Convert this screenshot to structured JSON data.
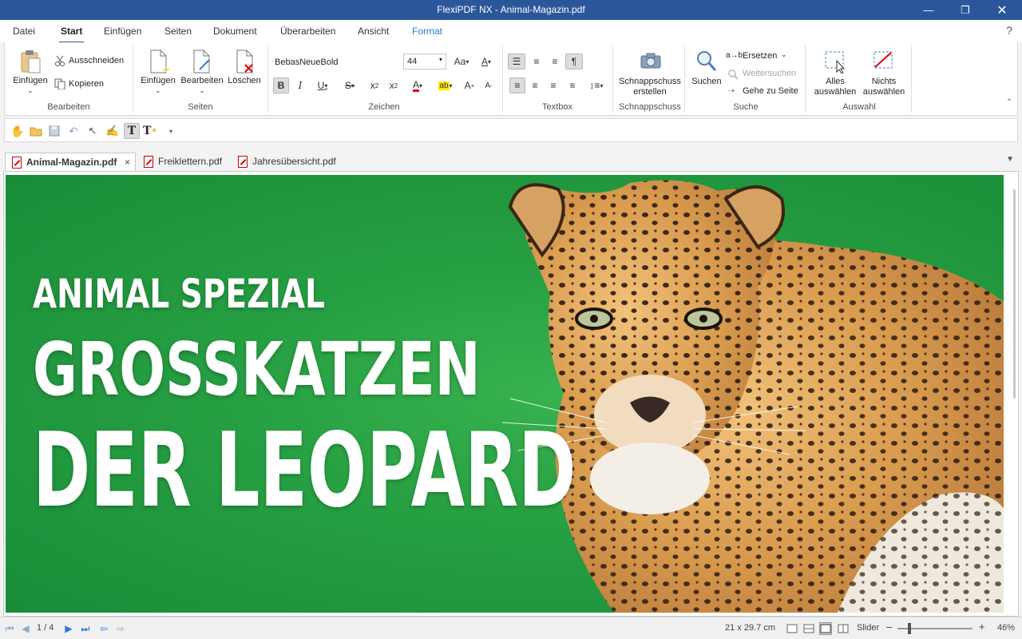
{
  "window": {
    "title": "FlexiPDF NX - Animal-Magazin.pdf"
  },
  "menu": {
    "tabs": [
      "Datei",
      "Start",
      "Einfügen",
      "Seiten",
      "Dokument",
      "Überarbeiten",
      "Ansicht",
      "Format"
    ],
    "active": "Start",
    "help": "?"
  },
  "ribbon": {
    "bearbeiten": {
      "label": "Bearbeiten",
      "paste": "Einfügen",
      "cut": "Ausschneiden",
      "copy": "Kopieren"
    },
    "seiten": {
      "label": "Seiten",
      "insert": "Einfügen",
      "edit": "Bearbeiten",
      "delete": "Löschen"
    },
    "zeichen": {
      "label": "Zeichen",
      "font": "BebasNeueBold",
      "size": "44"
    },
    "textbox": {
      "label": "Textbox"
    },
    "schnappschuss": {
      "label": "Schnappschuss",
      "button_line1": "Schnappschuss",
      "button_line2": "erstellen"
    },
    "suche": {
      "label": "Suche",
      "search": "Suchen",
      "replace": "Ersetzen",
      "find_next": "Weitersuchen",
      "goto_page": "Gehe zu Seite"
    },
    "auswahl": {
      "label": "Auswahl",
      "select_all_1": "Alles",
      "select_all_2": "auswählen",
      "select_none_1": "Nichts",
      "select_none_2": "auswählen"
    }
  },
  "doc_tabs": [
    {
      "label": "Animal-Magazin.pdf",
      "active": true
    },
    {
      "label": "Freiklettern.pdf",
      "active": false
    },
    {
      "label": "Jahresübersicht.pdf",
      "active": false
    }
  ],
  "page": {
    "line1": "ANIMAL SPEZIAL",
    "line2": "GROSSKATZEN",
    "line3": "DER LEOPARD",
    "background_color": "#27a043"
  },
  "status": {
    "page_indicator": "1 / 4",
    "page_size": "21 x 29.7 cm",
    "slider_label": "Slider",
    "zoom": "46%"
  },
  "colors": {
    "titlebar": "#2b579a",
    "accent": "#2b79c9",
    "pdf_red": "#cc0000"
  }
}
